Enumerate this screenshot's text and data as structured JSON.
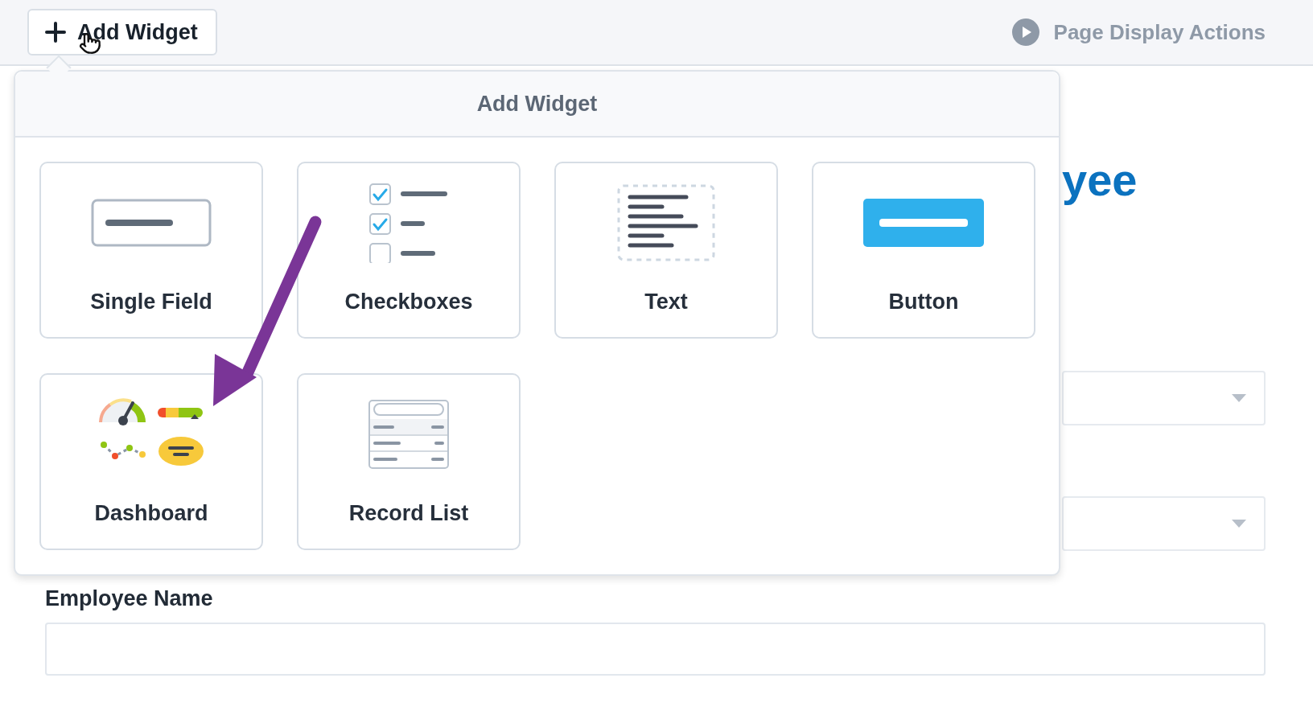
{
  "toolbar": {
    "add_button": {
      "label": "Add Widget"
    },
    "actions_link": {
      "label": "Page Display Actions"
    }
  },
  "popover": {
    "title": "Add Widget",
    "widgets": [
      {
        "kind": "single_field",
        "label": "Single Field"
      },
      {
        "kind": "checkboxes",
        "label": "Checkboxes"
      },
      {
        "kind": "text",
        "label": "Text"
      },
      {
        "kind": "button",
        "label": "Button"
      },
      {
        "kind": "dashboard",
        "label": "Dashboard"
      },
      {
        "kind": "record_list",
        "label": "Record List"
      }
    ]
  },
  "page": {
    "heading": "yee",
    "dropdowns": [
      {
        "kind": "select"
      },
      {
        "kind": "select"
      }
    ],
    "field": {
      "label": "Employee Name"
    }
  }
}
